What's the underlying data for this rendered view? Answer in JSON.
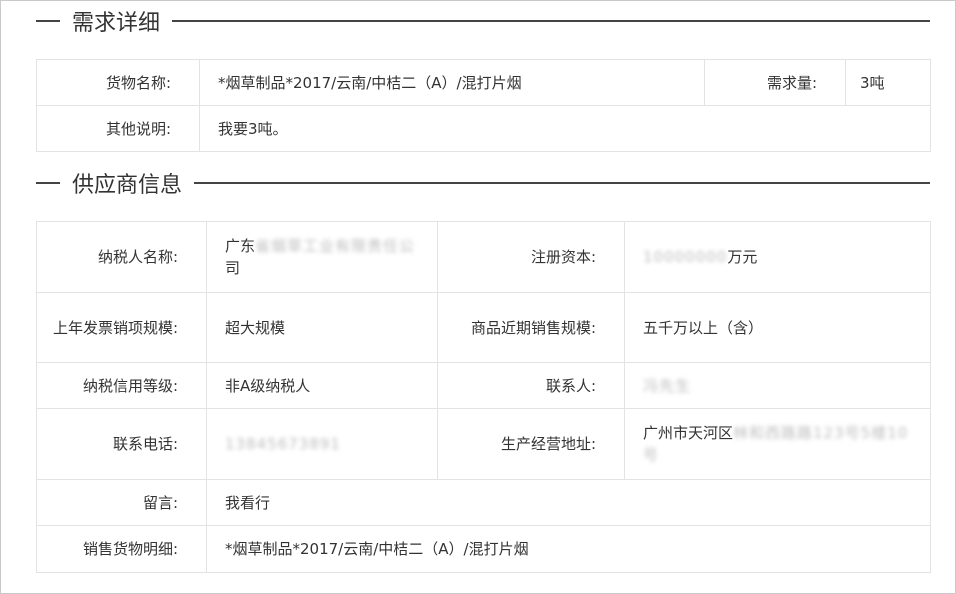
{
  "demand_section": {
    "title": "需求详细",
    "goods_name_label": "货物名称:",
    "goods_name_value": "*烟草制品*2017/云南/中桔二（A）/混打片烟",
    "quantity_label": "需求量:",
    "quantity_value": "3吨",
    "other_notes_label": "其他说明:",
    "other_notes_value": "我要3吨。"
  },
  "supplier_section": {
    "title": "供应商信息",
    "taxpayer_name_label": "纳税人名称:",
    "taxpayer_name_visible": "广东",
    "taxpayer_name_redacted": "省烟草工业有限责任公",
    "taxpayer_name_tail": "司",
    "registered_capital_label": "注册资本:",
    "registered_capital_redacted": "10000000",
    "registered_capital_unit": "万元",
    "invoice_scale_label": "上年发票销项规模:",
    "invoice_scale_value": "超大规模",
    "recent_sales_label": "商品近期销售规模:",
    "recent_sales_value": "五千万以上（含）",
    "credit_level_label": "纳税信用等级:",
    "credit_level_value": "非A级纳税人",
    "contact_label": "联系人:",
    "contact_redacted": "冯先生",
    "phone_label": "联系电话:",
    "phone_redacted": "13845673891",
    "address_label": "生产经营地址:",
    "address_visible": "广州市天河区",
    "address_redacted": "林和西路路123号5楼10",
    "address_tail_redacted": "号",
    "message_label": "留言:",
    "message_value": "我看行",
    "sales_goods_label": "销售货物明细:",
    "sales_goods_value": "*烟草制品*2017/云南/中桔二（A）/混打片烟"
  }
}
